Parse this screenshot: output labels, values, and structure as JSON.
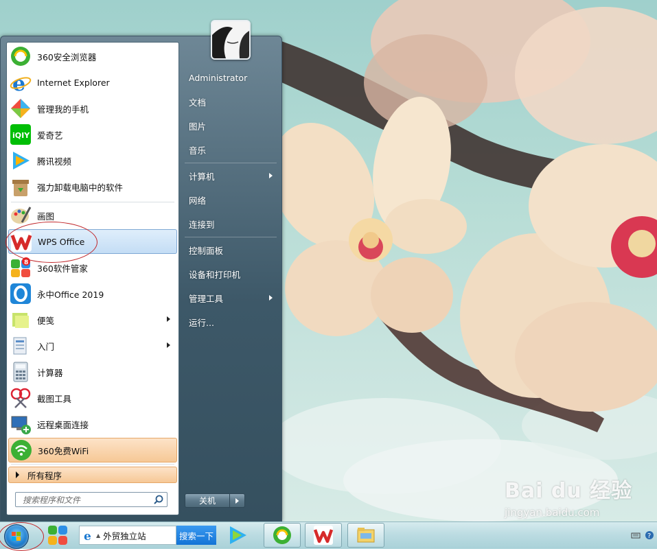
{
  "start_menu": {
    "programs": [
      {
        "label": "360安全浏览器",
        "icon": "360-browser-icon"
      },
      {
        "label": "Internet Explorer",
        "icon": "ie-icon"
      },
      {
        "label": "管理我的手机",
        "icon": "phone-manager-icon"
      },
      {
        "label": "爱奇艺",
        "icon": "iqiyi-icon"
      },
      {
        "label": "腾讯视频",
        "icon": "tencent-video-icon"
      },
      {
        "label": "强力卸载电脑中的软件",
        "icon": "uninstall-icon"
      },
      {
        "label": "画图",
        "icon": "paint-icon"
      },
      {
        "label": "WPS Office",
        "icon": "wps-icon"
      },
      {
        "label": "360软件管家",
        "icon": "360-software-manager-icon",
        "badge": "8"
      },
      {
        "label": "永中Office 2019",
        "icon": "yozo-office-icon"
      },
      {
        "label": "便笺",
        "icon": "sticky-notes-icon"
      },
      {
        "label": "入门",
        "icon": "getting-started-icon"
      },
      {
        "label": "计算器",
        "icon": "calculator-icon"
      },
      {
        "label": "截图工具",
        "icon": "snipping-tool-icon"
      },
      {
        "label": "远程桌面连接",
        "icon": "remote-desktop-icon"
      },
      {
        "label": "360免费WiFi",
        "icon": "wifi-icon"
      }
    ],
    "all_programs": "所有程序",
    "search_placeholder": "搜索程序和文件",
    "right_items": [
      {
        "label": "Administrator"
      },
      {
        "label": "文档"
      },
      {
        "label": "图片"
      },
      {
        "label": "音乐"
      },
      {
        "label": "计算机"
      },
      {
        "label": "网络"
      },
      {
        "label": "连接到"
      },
      {
        "label": "控制面板"
      },
      {
        "label": "设备和打印机"
      },
      {
        "label": "管理工具"
      },
      {
        "label": "运行..."
      }
    ],
    "shutdown_label": "关机"
  },
  "taskbar": {
    "search_text": "外贸独立站",
    "search_button": "搜索一下"
  },
  "watermark": {
    "logo": "Bai du 经验",
    "url": "jingyan.baidu.com"
  },
  "colors": {
    "highlight": "#c0262a",
    "wps_red": "#d62a2a",
    "selected_bg": "#c4ddf5"
  }
}
